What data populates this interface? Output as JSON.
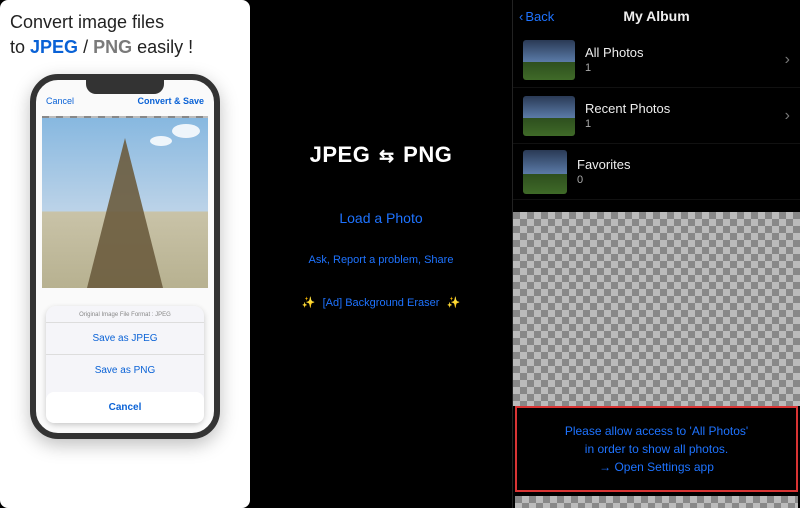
{
  "panel1": {
    "headline_prefix": "Convert image files",
    "headline_to": "to ",
    "jpeg": "JPEG",
    "slash": " / ",
    "png": "PNG",
    "headline_suffix": " easily !",
    "phone": {
      "left_action": "Cancel",
      "right_action": "Convert & Save",
      "sheet_hint": "Original Image File Format : JPEG",
      "save_jpeg": "Save as JPEG",
      "save_png": "Save as PNG",
      "cancel": "Cancel"
    }
  },
  "panel2": {
    "logo_left": "JPEG",
    "logo_right": "PNG",
    "load": "Load a Photo",
    "ask": "Ask, Report a problem, Share",
    "ad": "[Ad] Background Eraser"
  },
  "panel3": {
    "back": "Back",
    "title": "My Album",
    "albums": [
      {
        "name": "All Photos",
        "count": "1",
        "chevron": true,
        "thumb": "photo"
      },
      {
        "name": "Recent Photos",
        "count": "1",
        "chevron": true,
        "thumb": "photo"
      },
      {
        "name": "Favorites",
        "count": "0",
        "chevron": false,
        "thumb": "checker"
      }
    ],
    "perm_line1": "Please allow access to 'All Photos'",
    "perm_line2": "in order to show all photos.",
    "perm_line3": "→ Open Settings app"
  }
}
